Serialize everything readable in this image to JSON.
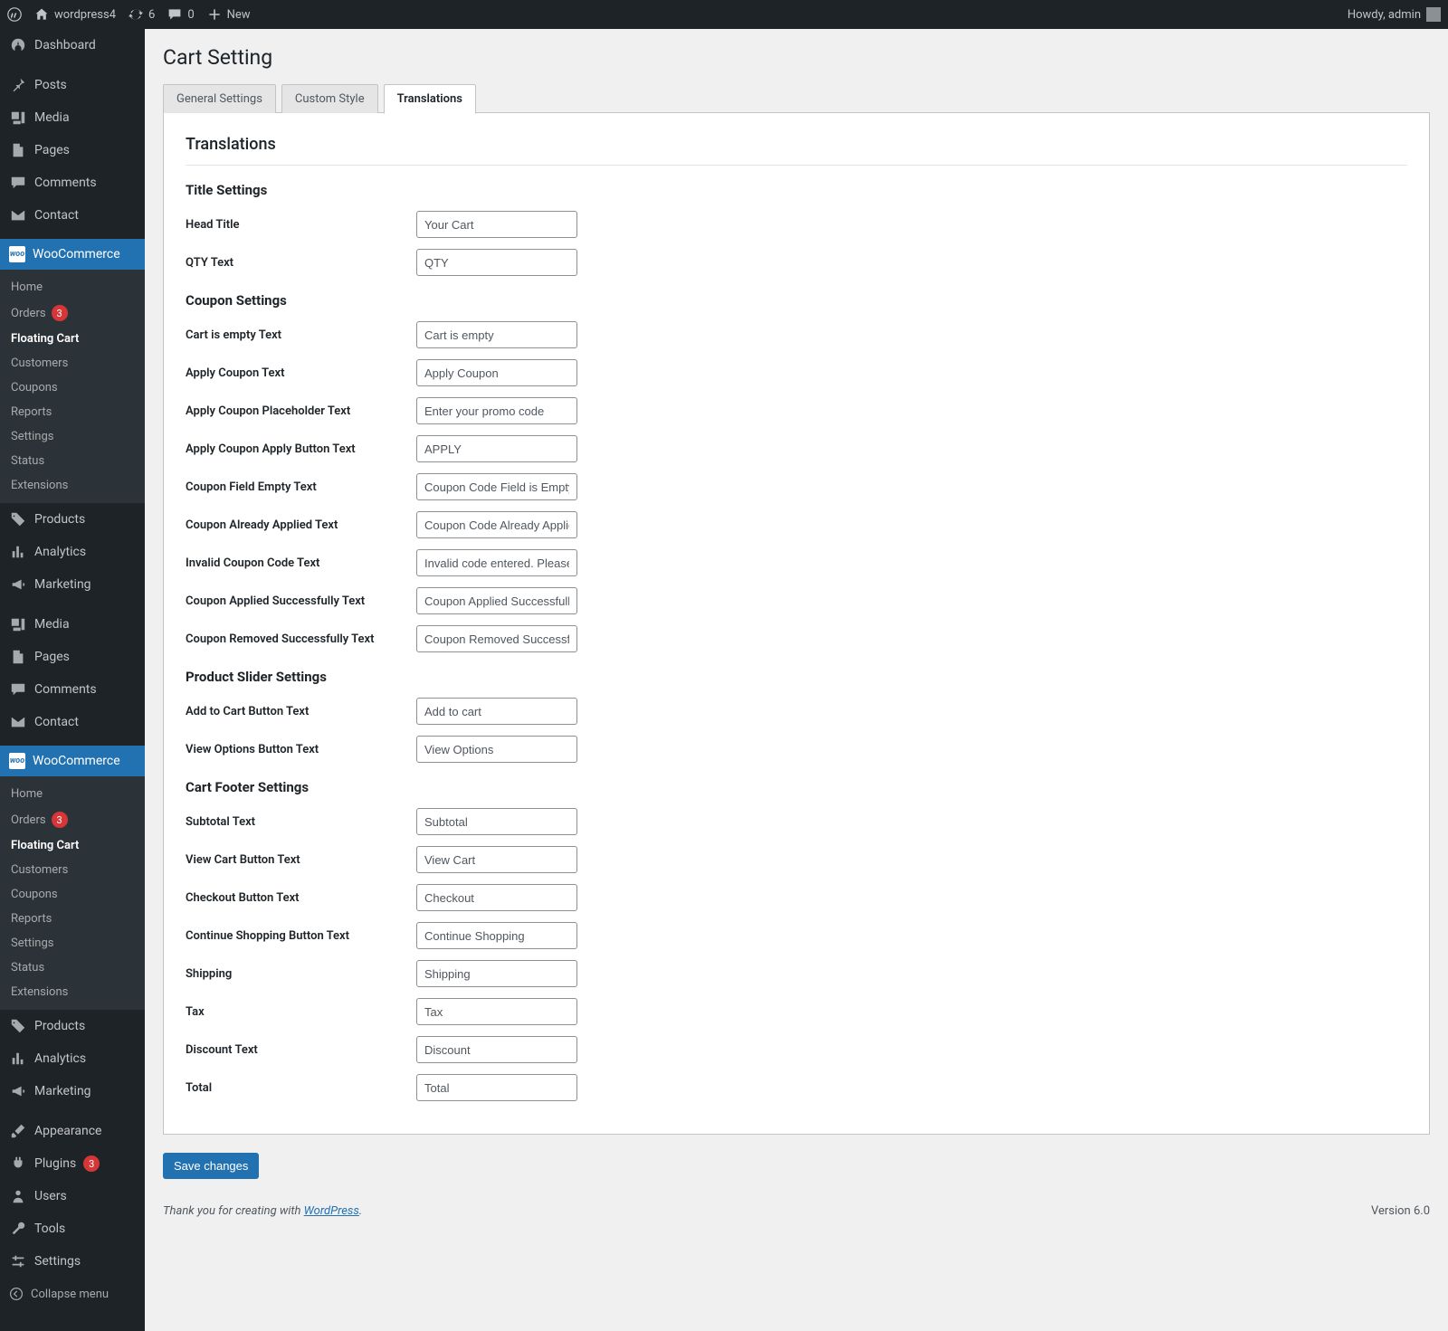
{
  "topbar": {
    "site_name": "wordpress4",
    "refresh_count": "6",
    "comments_count": "0",
    "new_label": "New",
    "howdy": "Howdy, admin"
  },
  "sidebar": {
    "dashboard": "Dashboard",
    "posts": "Posts",
    "media": "Media",
    "pages": "Pages",
    "comments": "Comments",
    "contact": "Contact",
    "woocommerce": "WooCommerce",
    "products": "Products",
    "analytics": "Analytics",
    "marketing": "Marketing",
    "appearance": "Appearance",
    "plugins": "Plugins",
    "plugins_badge": "3",
    "users": "Users",
    "tools": "Tools",
    "settings": "Settings",
    "collapse": "Collapse menu",
    "woo_sub": {
      "home": "Home",
      "orders": "Orders",
      "orders_badge": "3",
      "floating_cart": "Floating Cart",
      "customers": "Customers",
      "coupons": "Coupons",
      "reports": "Reports",
      "settings": "Settings",
      "status": "Status",
      "extensions": "Extensions"
    }
  },
  "page": {
    "title": "Cart Setting",
    "tabs": {
      "general": "General Settings",
      "custom_style": "Custom Style",
      "translations": "Translations"
    },
    "panel_heading": "Translations",
    "sections": {
      "title_settings": "Title Settings",
      "coupon_settings": "Coupon Settings",
      "product_slider": "Product Slider Settings",
      "cart_footer": "Cart Footer Settings"
    },
    "fields": {
      "head_title": {
        "label": "Head Title",
        "value": "Your Cart"
      },
      "qty_text": {
        "label": "QTY Text",
        "value": "QTY"
      },
      "cart_empty": {
        "label": "Cart is empty Text",
        "value": "Cart is empty"
      },
      "apply_coupon": {
        "label": "Apply Coupon Text",
        "value": "Apply Coupon"
      },
      "apply_coupon_placeholder": {
        "label": "Apply Coupon Placeholder Text",
        "value": "Enter your promo code"
      },
      "apply_coupon_button": {
        "label": "Apply Coupon Apply Button Text",
        "value": "APPLY"
      },
      "coupon_field_empty": {
        "label": "Coupon Field Empty Text",
        "value": "Coupon Code Field is Empty"
      },
      "coupon_already_applied": {
        "label": "Coupon Already Applied Text",
        "value": "Coupon Code Already Applied"
      },
      "invalid_coupon": {
        "label": "Invalid Coupon Code Text",
        "value": "Invalid code entered. Please try again"
      },
      "coupon_applied_success": {
        "label": "Coupon Applied Successfully Text",
        "value": "Coupon Applied Successfully"
      },
      "coupon_removed_success": {
        "label": "Coupon Removed Successfully Text",
        "value": "Coupon Removed Successfully"
      },
      "add_to_cart": {
        "label": "Add to Cart Button Text",
        "value": "Add to cart"
      },
      "view_options": {
        "label": "View Options Button Text",
        "value": "View Options"
      },
      "subtotal": {
        "label": "Subtotal Text",
        "value": "Subtotal"
      },
      "view_cart": {
        "label": "View Cart Button Text",
        "value": "View Cart"
      },
      "checkout": {
        "label": "Checkout Button Text",
        "value": "Checkout"
      },
      "continue_shopping": {
        "label": "Continue Shopping Button Text",
        "value": "Continue Shopping"
      },
      "shipping": {
        "label": "Shipping",
        "value": "Shipping"
      },
      "tax": {
        "label": "Tax",
        "value": "Tax"
      },
      "discount": {
        "label": "Discount Text",
        "value": "Discount"
      },
      "total": {
        "label": "Total",
        "value": "Total"
      }
    },
    "save_button": "Save changes"
  },
  "footer": {
    "thanks_prefix": "Thank you for creating with ",
    "wp_link": "WordPress",
    "thanks_suffix": ".",
    "version": "Version 6.0"
  }
}
